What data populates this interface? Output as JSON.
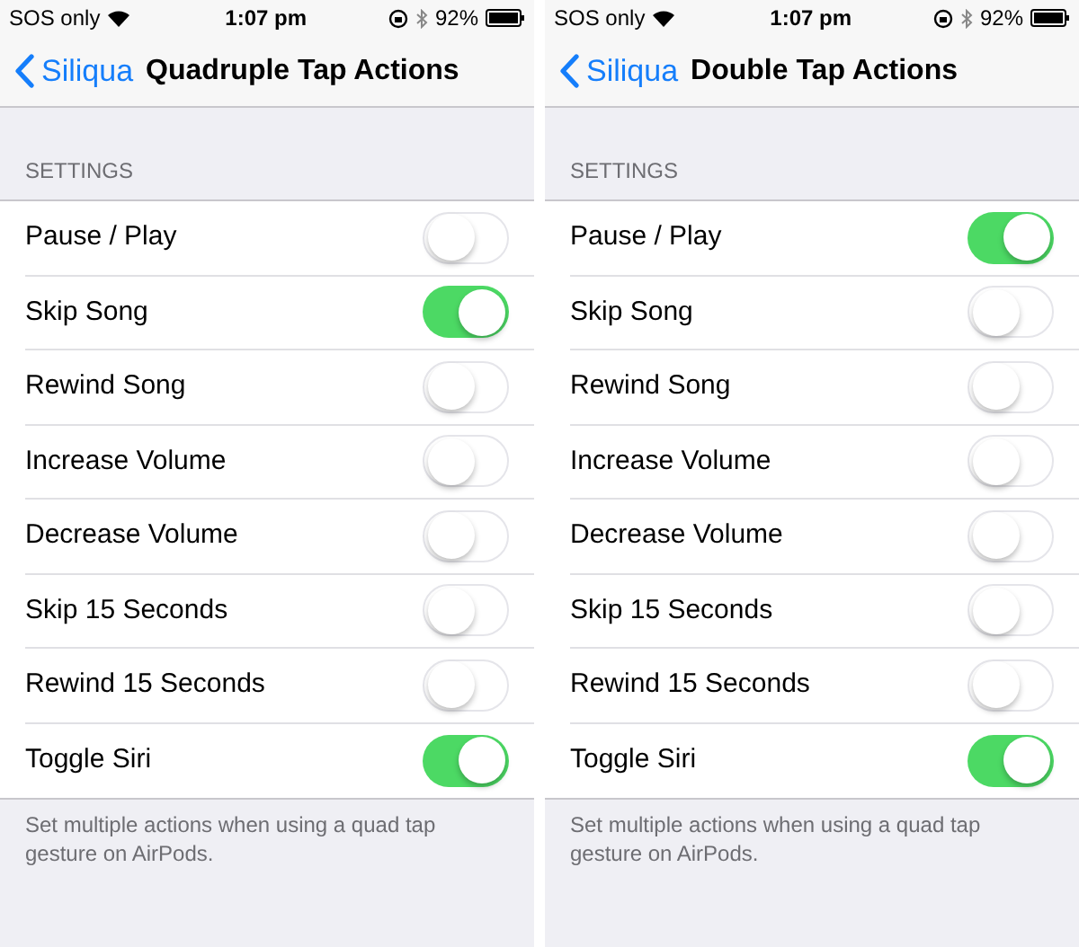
{
  "screens": [
    {
      "status_bar": {
        "carrier": "SOS only",
        "time": "1:07 pm",
        "battery": "92%"
      },
      "nav": {
        "back": "Siliqua",
        "title": "Quadruple Tap Actions"
      },
      "section_header": "SETTINGS",
      "rows": [
        {
          "label": "Pause / Play",
          "on": false
        },
        {
          "label": "Skip Song",
          "on": true
        },
        {
          "label": "Rewind Song",
          "on": false
        },
        {
          "label": "Increase Volume",
          "on": false
        },
        {
          "label": "Decrease Volume",
          "on": false
        },
        {
          "label": "Skip 15 Seconds",
          "on": false
        },
        {
          "label": "Rewind 15 Seconds",
          "on": false
        },
        {
          "label": "Toggle Siri",
          "on": true
        }
      ],
      "footer": "Set multiple actions when using a quad tap gesture on AirPods."
    },
    {
      "status_bar": {
        "carrier": "SOS only",
        "time": "1:07 pm",
        "battery": "92%"
      },
      "nav": {
        "back": "Siliqua",
        "title": "Double Tap Actions"
      },
      "section_header": "SETTINGS",
      "rows": [
        {
          "label": "Pause / Play",
          "on": true
        },
        {
          "label": "Skip Song",
          "on": false
        },
        {
          "label": "Rewind Song",
          "on": false
        },
        {
          "label": "Increase Volume",
          "on": false
        },
        {
          "label": "Decrease Volume",
          "on": false
        },
        {
          "label": "Skip 15 Seconds",
          "on": false
        },
        {
          "label": "Rewind 15 Seconds",
          "on": false
        },
        {
          "label": "Toggle Siri",
          "on": true
        }
      ],
      "footer": "Set multiple actions when using a quad tap gesture on AirPods."
    }
  ]
}
